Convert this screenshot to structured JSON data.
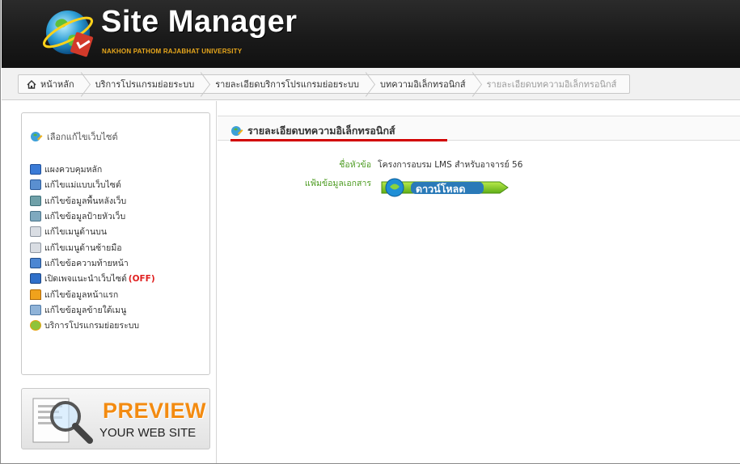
{
  "app": {
    "title": "Site Manager",
    "subtitle": "NAKHON PATHOM RAJABHAT UNIVERSITY"
  },
  "breadcrumb": [
    {
      "label": "หน้าหลัก",
      "icon": "home-icon"
    },
    {
      "label": "บริการโปรแกรมย่อยระบบ"
    },
    {
      "label": "รายละเอียดบริการโปรแกรมย่อยระบบ"
    },
    {
      "label": "บทความอิเล็กทรอนิกส์"
    },
    {
      "label": "รายละเอียดบทความอิเล็กทรอนิกส์"
    }
  ],
  "sidebar": {
    "header": "เลือกแก้ไขเว็บไซต์",
    "items": [
      {
        "label": "แผงควบคุมหลัก",
        "icon": "dashboard-icon"
      },
      {
        "label": "แก้ไขแม่แบบเว็บไซต์",
        "icon": "template-icon"
      },
      {
        "label": "แก้ไขข้อมูลพื้นหลังเว็บ",
        "icon": "background-icon"
      },
      {
        "label": "แก้ไขข้อมูลป้ายหัวเว็บ",
        "icon": "banner-icon"
      },
      {
        "label": "แก้ไขเมนูด้านบน",
        "icon": "top-menu-icon"
      },
      {
        "label": "แก้ไขเมนูด้านซ้ายมือ",
        "icon": "left-menu-icon"
      },
      {
        "label": "แก้ไขข้อความท้ายหน้า",
        "icon": "footer-icon"
      },
      {
        "label": "เปิดเพจแนะนำเว็บไซต์",
        "badge": "(OFF)",
        "icon": "intro-page-icon"
      },
      {
        "label": "แก้ไขข้อมูลหน้าแรก",
        "icon": "home-page-icon"
      },
      {
        "label": "แก้ไขข้อมูลข้ายใต้เมนู",
        "icon": "sub-menu-icon"
      },
      {
        "label": "บริการโปรแกรมย่อยระบบ",
        "icon": "services-icon"
      }
    ]
  },
  "preview": {
    "title": "PREVIEW",
    "subtitle": "YOUR WEB SITE"
  },
  "content": {
    "title": "รายละเอียดบทความอิเล็กทรอนิกส์",
    "fields": {
      "topic_label": "ชื่อหัวข้อ",
      "topic_value": "โครงการอบรม LMS สำหรับอาจารย์ 56",
      "file_label": "แฟ้มข้อมูลเอกสาร",
      "download_label": "ดาวน์โหลด"
    }
  },
  "colors": {
    "header_bg": "#1a1a1a",
    "subtitle": "#e9a81c",
    "label_green": "#4a9a1e",
    "title_underline": "#d20000",
    "off_badge": "#e02020",
    "preview_orange": "#f38b11"
  }
}
